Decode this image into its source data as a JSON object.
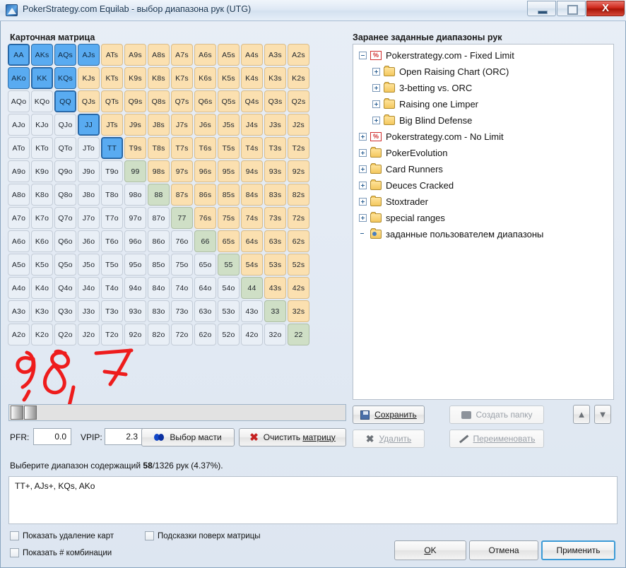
{
  "window": {
    "title": "PokerStrategy.com Equilab - выбор диапазона рук (UTG)",
    "app_icon": "equilab-icon",
    "minimize_label": "",
    "maximize_label": "",
    "close_label": "X"
  },
  "sections": {
    "matrix_title": "Карточная матрица",
    "tree_title": "Заранее заданные диапазоны рук"
  },
  "matrix": {
    "ranks": [
      "A",
      "K",
      "Q",
      "J",
      "T",
      "9",
      "8",
      "7",
      "6",
      "5",
      "4",
      "3",
      "2"
    ],
    "rows": [
      [
        {
          "label": "AA",
          "state": "selected"
        },
        {
          "label": "AKs",
          "state": "selected"
        },
        {
          "label": "AQs",
          "state": "selected"
        },
        {
          "label": "AJs",
          "state": "selected"
        },
        {
          "label": "ATs",
          "state": "suited"
        },
        {
          "label": "A9s",
          "state": "suited"
        },
        {
          "label": "A8s",
          "state": "suited"
        },
        {
          "label": "A7s",
          "state": "suited"
        },
        {
          "label": "A6s",
          "state": "suited"
        },
        {
          "label": "A5s",
          "state": "suited"
        },
        {
          "label": "A4s",
          "state": "suited"
        },
        {
          "label": "A3s",
          "state": "suited"
        },
        {
          "label": "A2s",
          "state": "suited"
        }
      ],
      [
        {
          "label": "AKo",
          "state": "selected"
        },
        {
          "label": "KK",
          "state": "selected"
        },
        {
          "label": "KQs",
          "state": "selected"
        },
        {
          "label": "KJs",
          "state": "suited"
        },
        {
          "label": "KTs",
          "state": "suited"
        },
        {
          "label": "K9s",
          "state": "suited"
        },
        {
          "label": "K8s",
          "state": "suited"
        },
        {
          "label": "K7s",
          "state": "suited"
        },
        {
          "label": "K6s",
          "state": "suited"
        },
        {
          "label": "K5s",
          "state": "suited"
        },
        {
          "label": "K4s",
          "state": "suited"
        },
        {
          "label": "K3s",
          "state": "suited"
        },
        {
          "label": "K2s",
          "state": "suited"
        }
      ],
      [
        {
          "label": "AQo",
          "state": "offsuit"
        },
        {
          "label": "KQo",
          "state": "offsuit"
        },
        {
          "label": "QQ",
          "state": "selected"
        },
        {
          "label": "QJs",
          "state": "suited"
        },
        {
          "label": "QTs",
          "state": "suited"
        },
        {
          "label": "Q9s",
          "state": "suited"
        },
        {
          "label": "Q8s",
          "state": "suited"
        },
        {
          "label": "Q7s",
          "state": "suited"
        },
        {
          "label": "Q6s",
          "state": "suited"
        },
        {
          "label": "Q5s",
          "state": "suited"
        },
        {
          "label": "Q4s",
          "state": "suited"
        },
        {
          "label": "Q3s",
          "state": "suited"
        },
        {
          "label": "Q2s",
          "state": "suited"
        }
      ],
      [
        {
          "label": "AJo",
          "state": "offsuit"
        },
        {
          "label": "KJo",
          "state": "offsuit"
        },
        {
          "label": "QJo",
          "state": "offsuit"
        },
        {
          "label": "JJ",
          "state": "selected"
        },
        {
          "label": "JTs",
          "state": "suited"
        },
        {
          "label": "J9s",
          "state": "suited"
        },
        {
          "label": "J8s",
          "state": "suited"
        },
        {
          "label": "J7s",
          "state": "suited"
        },
        {
          "label": "J6s",
          "state": "suited"
        },
        {
          "label": "J5s",
          "state": "suited"
        },
        {
          "label": "J4s",
          "state": "suited"
        },
        {
          "label": "J3s",
          "state": "suited"
        },
        {
          "label": "J2s",
          "state": "suited"
        }
      ],
      [
        {
          "label": "ATo",
          "state": "offsuit"
        },
        {
          "label": "KTo",
          "state": "offsuit"
        },
        {
          "label": "QTo",
          "state": "offsuit"
        },
        {
          "label": "JTo",
          "state": "offsuit"
        },
        {
          "label": "TT",
          "state": "selected"
        },
        {
          "label": "T9s",
          "state": "suited"
        },
        {
          "label": "T8s",
          "state": "suited"
        },
        {
          "label": "T7s",
          "state": "suited"
        },
        {
          "label": "T6s",
          "state": "suited"
        },
        {
          "label": "T5s",
          "state": "suited"
        },
        {
          "label": "T4s",
          "state": "suited"
        },
        {
          "label": "T3s",
          "state": "suited"
        },
        {
          "label": "T2s",
          "state": "suited"
        }
      ],
      [
        {
          "label": "A9o",
          "state": "offsuit"
        },
        {
          "label": "K9o",
          "state": "offsuit"
        },
        {
          "label": "Q9o",
          "state": "offsuit"
        },
        {
          "label": "J9o",
          "state": "offsuit"
        },
        {
          "label": "T9o",
          "state": "offsuit"
        },
        {
          "label": "99",
          "state": "pair"
        },
        {
          "label": "98s",
          "state": "suited"
        },
        {
          "label": "97s",
          "state": "suited"
        },
        {
          "label": "96s",
          "state": "suited"
        },
        {
          "label": "95s",
          "state": "suited"
        },
        {
          "label": "94s",
          "state": "suited"
        },
        {
          "label": "93s",
          "state": "suited"
        },
        {
          "label": "92s",
          "state": "suited"
        }
      ],
      [
        {
          "label": "A8o",
          "state": "offsuit"
        },
        {
          "label": "K8o",
          "state": "offsuit"
        },
        {
          "label": "Q8o",
          "state": "offsuit"
        },
        {
          "label": "J8o",
          "state": "offsuit"
        },
        {
          "label": "T8o",
          "state": "offsuit"
        },
        {
          "label": "98o",
          "state": "offsuit"
        },
        {
          "label": "88",
          "state": "pair"
        },
        {
          "label": "87s",
          "state": "suited"
        },
        {
          "label": "86s",
          "state": "suited"
        },
        {
          "label": "85s",
          "state": "suited"
        },
        {
          "label": "84s",
          "state": "suited"
        },
        {
          "label": "83s",
          "state": "suited"
        },
        {
          "label": "82s",
          "state": "suited"
        }
      ],
      [
        {
          "label": "A7o",
          "state": "offsuit"
        },
        {
          "label": "K7o",
          "state": "offsuit"
        },
        {
          "label": "Q7o",
          "state": "offsuit"
        },
        {
          "label": "J7o",
          "state": "offsuit"
        },
        {
          "label": "T7o",
          "state": "offsuit"
        },
        {
          "label": "97o",
          "state": "offsuit"
        },
        {
          "label": "87o",
          "state": "offsuit"
        },
        {
          "label": "77",
          "state": "pair"
        },
        {
          "label": "76s",
          "state": "suited"
        },
        {
          "label": "75s",
          "state": "suited"
        },
        {
          "label": "74s",
          "state": "suited"
        },
        {
          "label": "73s",
          "state": "suited"
        },
        {
          "label": "72s",
          "state": "suited"
        }
      ],
      [
        {
          "label": "A6o",
          "state": "offsuit"
        },
        {
          "label": "K6o",
          "state": "offsuit"
        },
        {
          "label": "Q6o",
          "state": "offsuit"
        },
        {
          "label": "J6o",
          "state": "offsuit"
        },
        {
          "label": "T6o",
          "state": "offsuit"
        },
        {
          "label": "96o",
          "state": "offsuit"
        },
        {
          "label": "86o",
          "state": "offsuit"
        },
        {
          "label": "76o",
          "state": "offsuit"
        },
        {
          "label": "66",
          "state": "pair"
        },
        {
          "label": "65s",
          "state": "suited"
        },
        {
          "label": "64s",
          "state": "suited"
        },
        {
          "label": "63s",
          "state": "suited"
        },
        {
          "label": "62s",
          "state": "suited"
        }
      ],
      [
        {
          "label": "A5o",
          "state": "offsuit"
        },
        {
          "label": "K5o",
          "state": "offsuit"
        },
        {
          "label": "Q5o",
          "state": "offsuit"
        },
        {
          "label": "J5o",
          "state": "offsuit"
        },
        {
          "label": "T5o",
          "state": "offsuit"
        },
        {
          "label": "95o",
          "state": "offsuit"
        },
        {
          "label": "85o",
          "state": "offsuit"
        },
        {
          "label": "75o",
          "state": "offsuit"
        },
        {
          "label": "65o",
          "state": "offsuit"
        },
        {
          "label": "55",
          "state": "pair"
        },
        {
          "label": "54s",
          "state": "suited"
        },
        {
          "label": "53s",
          "state": "suited"
        },
        {
          "label": "52s",
          "state": "suited"
        }
      ],
      [
        {
          "label": "A4o",
          "state": "offsuit"
        },
        {
          "label": "K4o",
          "state": "offsuit"
        },
        {
          "label": "Q4o",
          "state": "offsuit"
        },
        {
          "label": "J4o",
          "state": "offsuit"
        },
        {
          "label": "T4o",
          "state": "offsuit"
        },
        {
          "label": "94o",
          "state": "offsuit"
        },
        {
          "label": "84o",
          "state": "offsuit"
        },
        {
          "label": "74o",
          "state": "offsuit"
        },
        {
          "label": "64o",
          "state": "offsuit"
        },
        {
          "label": "54o",
          "state": "offsuit"
        },
        {
          "label": "44",
          "state": "pair"
        },
        {
          "label": "43s",
          "state": "suited"
        },
        {
          "label": "42s",
          "state": "suited"
        }
      ],
      [
        {
          "label": "A3o",
          "state": "offsuit"
        },
        {
          "label": "K3o",
          "state": "offsuit"
        },
        {
          "label": "Q3o",
          "state": "offsuit"
        },
        {
          "label": "J3o",
          "state": "offsuit"
        },
        {
          "label": "T3o",
          "state": "offsuit"
        },
        {
          "label": "93o",
          "state": "offsuit"
        },
        {
          "label": "83o",
          "state": "offsuit"
        },
        {
          "label": "73o",
          "state": "offsuit"
        },
        {
          "label": "63o",
          "state": "offsuit"
        },
        {
          "label": "53o",
          "state": "offsuit"
        },
        {
          "label": "43o",
          "state": "offsuit"
        },
        {
          "label": "33",
          "state": "pair"
        },
        {
          "label": "32s",
          "state": "suited"
        }
      ],
      [
        {
          "label": "A2o",
          "state": "offsuit"
        },
        {
          "label": "K2o",
          "state": "offsuit"
        },
        {
          "label": "Q2o",
          "state": "offsuit"
        },
        {
          "label": "J2o",
          "state": "offsuit"
        },
        {
          "label": "T2o",
          "state": "offsuit"
        },
        {
          "label": "92o",
          "state": "offsuit"
        },
        {
          "label": "82o",
          "state": "offsuit"
        },
        {
          "label": "72o",
          "state": "offsuit"
        },
        {
          "label": "62o",
          "state": "offsuit"
        },
        {
          "label": "52o",
          "state": "offsuit"
        },
        {
          "label": "42o",
          "state": "offsuit"
        },
        {
          "label": "32o",
          "state": "offsuit"
        },
        {
          "label": "22",
          "state": "pair"
        }
      ]
    ],
    "colors": {
      "selected": "#59abf1",
      "pair": "#cfdfc6",
      "suited": "#fbe0b0",
      "offsuit": "#e9eff6"
    }
  },
  "annotation": {
    "text": "9, 8, 7",
    "color": "#ee1c1c",
    "kind": "handwritten-ink"
  },
  "tree": {
    "nodes": [
      {
        "label": "Pokerstrategy.com - Fixed Limit",
        "depth": 0,
        "icon": "pokerstrategy-icon",
        "expander": "minus"
      },
      {
        "label": "Open Raising Chart (ORC)",
        "depth": 1,
        "icon": "folder-icon",
        "expander": "plus"
      },
      {
        "label": "3-betting vs. ORC",
        "depth": 1,
        "icon": "folder-icon",
        "expander": "plus"
      },
      {
        "label": "Raising one Limper",
        "depth": 1,
        "icon": "folder-icon",
        "expander": "plus"
      },
      {
        "label": "Big Blind Defense",
        "depth": 1,
        "icon": "folder-icon",
        "expander": "plus"
      },
      {
        "label": "Pokerstrategy.com - No Limit",
        "depth": 0,
        "icon": "pokerstrategy-icon",
        "expander": "plus"
      },
      {
        "label": "PokerEvolution",
        "depth": 0,
        "icon": "folder-icon",
        "expander": "plus"
      },
      {
        "label": "Card Runners",
        "depth": 0,
        "icon": "folder-icon",
        "expander": "plus"
      },
      {
        "label": "Deuces Cracked",
        "depth": 0,
        "icon": "folder-icon",
        "expander": "plus"
      },
      {
        "label": "Stoxtrader",
        "depth": 0,
        "icon": "folder-icon",
        "expander": "plus"
      },
      {
        "label": "special ranges",
        "depth": 0,
        "icon": "folder-icon",
        "expander": "plus"
      },
      {
        "label": "заданные пользователем диапазоны",
        "depth": 0,
        "icon": "user-folder-icon",
        "expander": "none"
      }
    ]
  },
  "tree_buttons": {
    "save": "Сохранить",
    "new_folder": "Создать папку",
    "delete": "Удалить",
    "rename": "Переименовать",
    "move_up": "▲",
    "move_down": "▼"
  },
  "stats": {
    "pfr_label": "PFR:",
    "pfr_value": "0.0",
    "vpip_label": "VPIP:",
    "vpip_value": "2.3",
    "suit_button": "Выбор масти",
    "clear_button": "Очистить матрицу",
    "clear_button_pre": "Очистить ",
    "clear_button_underlined": "матрицу"
  },
  "range": {
    "info_prefix": "Выберите диапазон содержащий ",
    "info_count": "58",
    "info_suffix": "/1326 рук (4.37%).",
    "text": "TT+, AJs+, KQs, AKo"
  },
  "checkboxes": {
    "card_removal": "Показать удаление карт",
    "tooltips": "Подсказки поверх матрицы",
    "combos": "Показать # комбинации"
  },
  "dialog_buttons": {
    "ok": "OK",
    "ok_underlined": "O",
    "ok_rest": "K",
    "cancel": "Отмена",
    "apply": "Применить"
  }
}
